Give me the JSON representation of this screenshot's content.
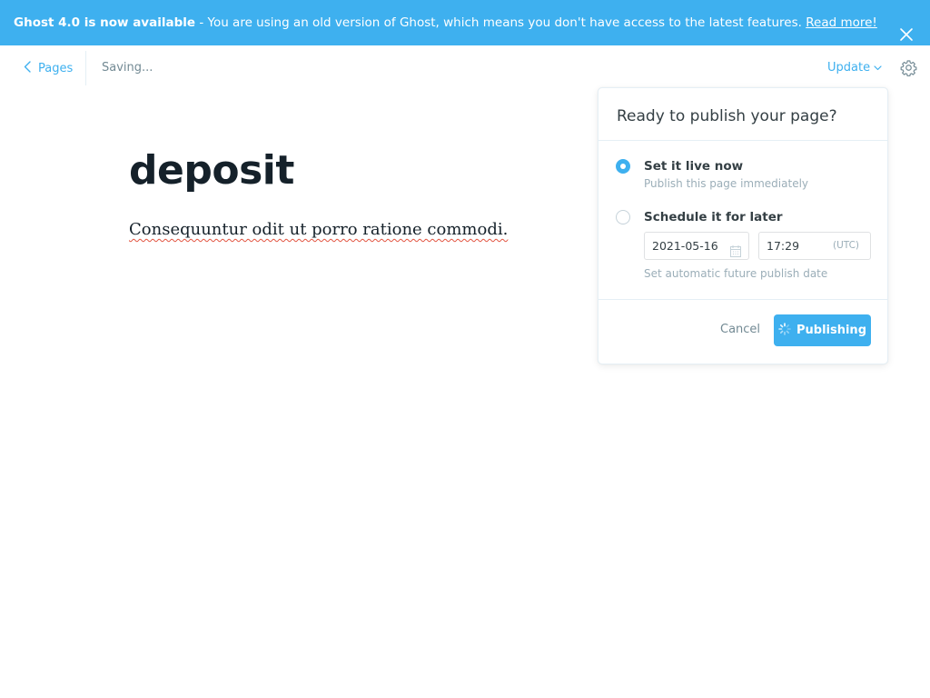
{
  "banner": {
    "strong_text": "Ghost 4.0 is now available",
    "message": " - You are using an old version of Ghost, which means you don't have access to the latest features. ",
    "link_text": "Read more!",
    "background": "#3eb0ef",
    "close_icon": "close-icon"
  },
  "header": {
    "back_label": "Pages",
    "back_icon": "chevron-left-icon",
    "save_status": "Saving...",
    "update_label": "Update",
    "update_icon": "chevron-down-icon",
    "settings_icon": "gear-icon"
  },
  "editor": {
    "title": "deposit",
    "body": "Consequuntur odit ut porro ratione commodi."
  },
  "publish_menu": {
    "title": "Ready to publish your page?",
    "options": [
      {
        "label": "Set it live now",
        "description": "Publish this page immediately",
        "selected": true
      },
      {
        "label": "Schedule it for later",
        "description": "Set automatic future publish date",
        "selected": false
      }
    ],
    "date_value": "2021-05-16",
    "date_icon": "calendar-icon",
    "time_value": "17:29",
    "timezone": "(UTC)",
    "cancel_label": "Cancel",
    "publish_label": "Publishing",
    "publish_icon": "spinner-icon",
    "accent_color": "#3eb0ef"
  }
}
